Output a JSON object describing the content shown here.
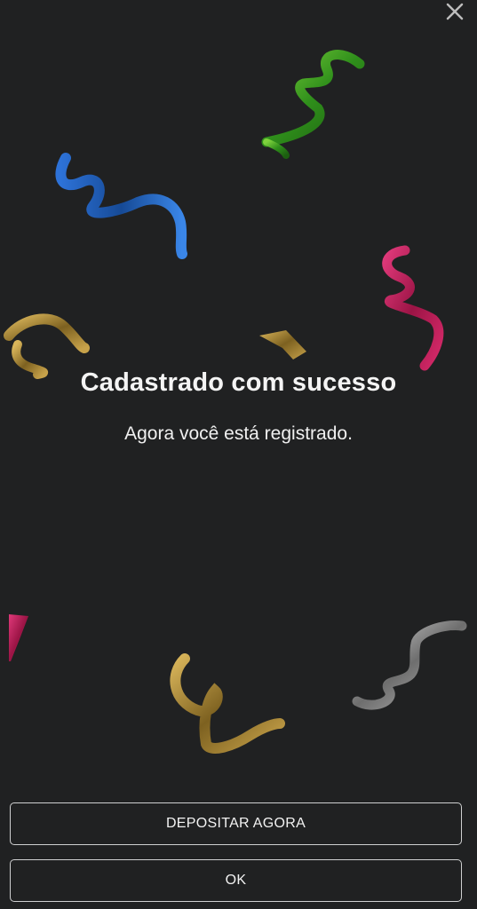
{
  "dialog": {
    "title": "Cadastrado com sucesso",
    "message": "Agora você está registrado.",
    "close_icon": "close-icon"
  },
  "actions": {
    "deposit_label": "DEPOSITAR AGORA",
    "ok_label": "OK"
  },
  "theme": {
    "background": "#202122",
    "button_border": "#cfd0d1",
    "confetti_colors": [
      "#3b8f1e",
      "#1f56a6",
      "#c01e5a",
      "#a8862c",
      "#9a9a9a"
    ]
  }
}
